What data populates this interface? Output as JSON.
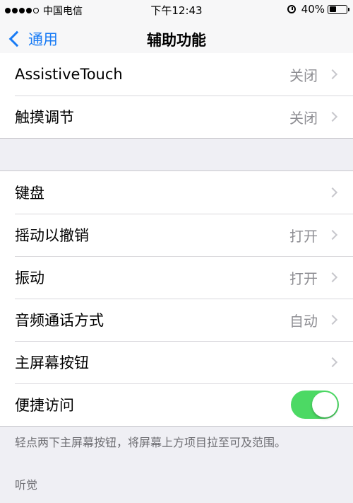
{
  "status_bar": {
    "carrier": "中国电信",
    "time": "下午12:43",
    "battery_percent": "40%",
    "battery_level": 0.4,
    "signal_filled": 4,
    "signal_total": 5
  },
  "nav": {
    "back_label": "通用",
    "title": "辅助功能"
  },
  "group1": [
    {
      "label": "AssistiveTouch",
      "value": "关闭"
    },
    {
      "label": "触摸调节",
      "value": "关闭"
    }
  ],
  "group2": [
    {
      "label": "键盘",
      "value": ""
    },
    {
      "label": "摇动以撤销",
      "value": "打开"
    },
    {
      "label": "振动",
      "value": "打开"
    },
    {
      "label": "音频通话方式",
      "value": "自动"
    },
    {
      "label": "主屏幕按钮",
      "value": ""
    },
    {
      "label": "便捷访问",
      "toggle_on": true
    }
  ],
  "footer_note": "轻点两下主屏幕按钮，将屏幕上方项目拉至可及范围。",
  "section_header": "听觉",
  "colors": {
    "accent": "#1a7cf5",
    "toggle_on": "#4cd964",
    "background": "#efeff4"
  }
}
